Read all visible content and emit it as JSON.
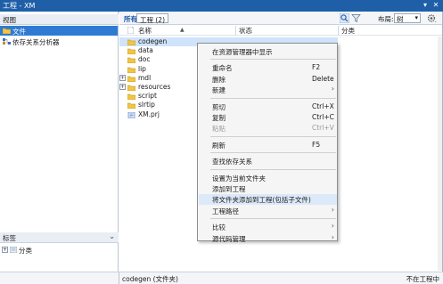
{
  "window": {
    "title": "工程 - XM"
  },
  "left_panel": {
    "views_header": "视图",
    "views": [
      {
        "label": "文件",
        "icon": "folder-icon",
        "selected": true
      },
      {
        "label": "依存关系分析器",
        "icon": "dependency-icon",
        "selected": false
      }
    ],
    "labels_header": "标签",
    "labels": [
      {
        "label": "分类",
        "expander": "+"
      }
    ]
  },
  "toolbar": {
    "tab_all": "所有",
    "tab_project": "工程 (2)",
    "layout_label": "布局:",
    "layout_value": "树"
  },
  "columns": {
    "name": "名称",
    "sort_indicator": "▲",
    "status": "状态",
    "category": "分类"
  },
  "files": [
    {
      "name": "codegen",
      "type": "folder",
      "expander": "",
      "selected": true
    },
    {
      "name": "data",
      "type": "folder",
      "expander": ""
    },
    {
      "name": "doc",
      "type": "folder",
      "expander": ""
    },
    {
      "name": "lip",
      "type": "folder",
      "expander": ""
    },
    {
      "name": "mdl",
      "type": "folder",
      "expander": "+"
    },
    {
      "name": "resources",
      "type": "folder",
      "expander": "+"
    },
    {
      "name": "script",
      "type": "folder",
      "expander": ""
    },
    {
      "name": "slrtip",
      "type": "folder",
      "expander": ""
    },
    {
      "name": "XM.prj",
      "type": "project-file",
      "expander": ""
    }
  ],
  "context_menu": {
    "groups": [
      [
        {
          "label": "在资源管理器中显示",
          "shortcut": "",
          "submenu": false
        }
      ],
      [
        {
          "label": "重命名",
          "shortcut": "F2",
          "submenu": false
        },
        {
          "label": "删除",
          "shortcut": "Delete",
          "submenu": false
        },
        {
          "label": "新建",
          "shortcut": "",
          "submenu": true
        }
      ],
      [
        {
          "label": "剪切",
          "shortcut": "Ctrl+X",
          "submenu": false
        },
        {
          "label": "复制",
          "shortcut": "Ctrl+C",
          "submenu": false
        },
        {
          "label": "粘贴",
          "shortcut": "Ctrl+V",
          "submenu": false,
          "disabled": true
        }
      ],
      [
        {
          "label": "刷新",
          "shortcut": "F5",
          "submenu": false
        }
      ],
      [
        {
          "label": "查找依存关系",
          "shortcut": "",
          "submenu": false
        }
      ],
      [
        {
          "label": "设置为当前文件夹",
          "shortcut": "",
          "submenu": false
        },
        {
          "label": "添加到工程",
          "shortcut": "",
          "submenu": false
        },
        {
          "label": "将文件夹添加到工程(包括子文件)",
          "shortcut": "",
          "submenu": false,
          "highlighted": true
        },
        {
          "label": "工程路径",
          "shortcut": "",
          "submenu": true
        }
      ],
      [
        {
          "label": "比较",
          "shortcut": "",
          "submenu": true
        },
        {
          "label": "源代码管理",
          "shortcut": "",
          "submenu": true
        }
      ]
    ]
  },
  "status": {
    "left": "codegen (文件夹)",
    "right": "不在工程中"
  },
  "colors": {
    "accent": "#2f7bd3",
    "title_bar": "#1e5fa8",
    "folder": "#f4c542"
  }
}
